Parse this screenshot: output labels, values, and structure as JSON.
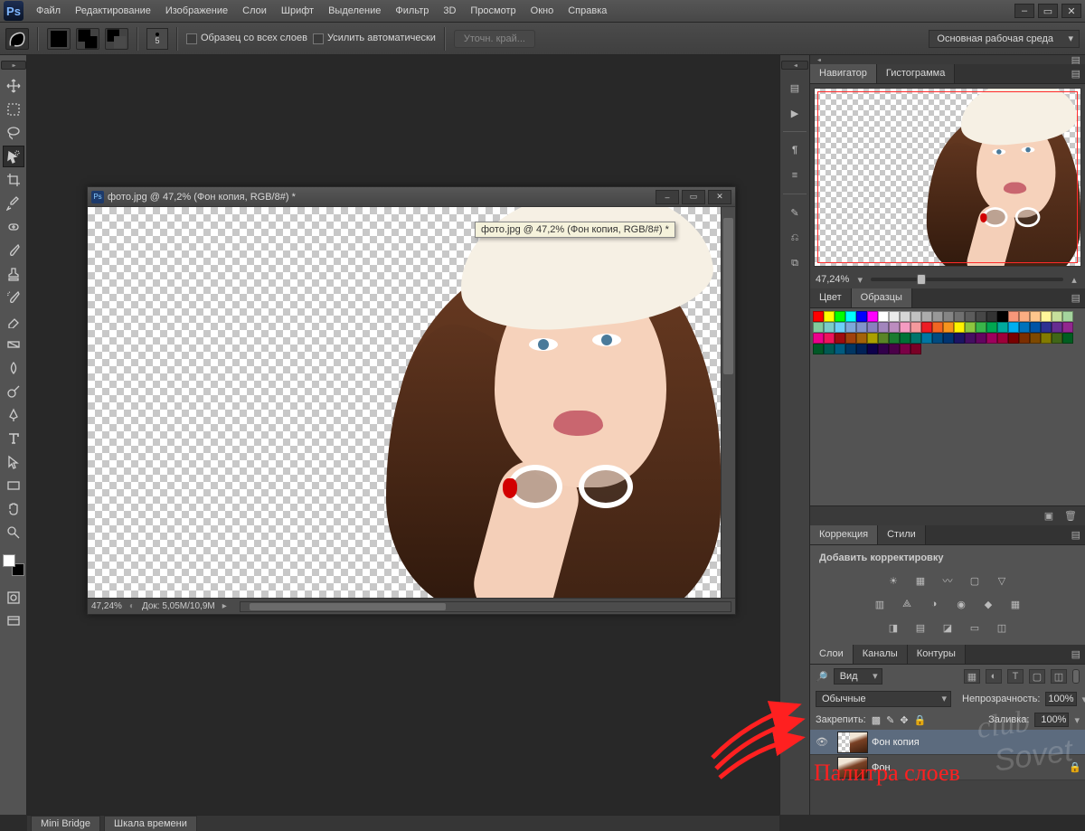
{
  "app": {
    "logo": "Ps"
  },
  "menu": {
    "items": [
      "Файл",
      "Редактирование",
      "Изображение",
      "Слои",
      "Шрифт",
      "Выделение",
      "Фильтр",
      "3D",
      "Просмотр",
      "Окно",
      "Справка"
    ]
  },
  "options_bar": {
    "brush_size_label": "5",
    "sample_all_label": "Образец со всех слоев",
    "auto_enhance_label": "Усилить автоматически",
    "refine_edge_label": "Уточн. край...",
    "workspace_label": "Основная рабочая среда"
  },
  "document": {
    "title": "фото.jpg @ 47,2% (Фон копия, RGB/8#) *",
    "tooltip": "фото.jpg @ 47,2% (Фон копия, RGB/8#) *",
    "status_zoom": "47,24%",
    "status_doc": "Док: 5,05M/10,9M"
  },
  "panels": {
    "navigator": {
      "tabs": [
        "Навигатор",
        "Гистограмма"
      ],
      "active": 0,
      "zoom_label": "47,24%"
    },
    "color": {
      "tabs": [
        "Цвет",
        "Образцы"
      ],
      "active": 1
    },
    "adjustments": {
      "tabs": [
        "Коррекция",
        "Стили"
      ],
      "active": 0,
      "add_label": "Добавить корректировку"
    },
    "layers": {
      "tabs": [
        "Слои",
        "Каналы",
        "Контуры"
      ],
      "active": 0,
      "filter_kind_label": "Вид",
      "blend_mode_label": "Обычные",
      "opacity_label": "Непрозрачность:",
      "opacity_value": "100%",
      "lock_label": "Закрепить:",
      "fill_label": "Заливка:",
      "fill_value": "100%",
      "items": [
        {
          "name": "Фон копия",
          "visible": true,
          "selected": true,
          "locked": false,
          "transparent_bg": true
        },
        {
          "name": "Фон",
          "visible": false,
          "selected": false,
          "locked": true,
          "transparent_bg": false
        }
      ]
    }
  },
  "bottom_tabs": [
    "Mini Bridge",
    "Шкала времени"
  ],
  "annotation": {
    "label": "Палитра слоев"
  },
  "swatch_colors": [
    "#ff0000",
    "#ffff00",
    "#00ff00",
    "#00ffff",
    "#0000ff",
    "#ff00ff",
    "#ffffff",
    "#ebebeb",
    "#d6d6d6",
    "#c2c2c2",
    "#adadad",
    "#999999",
    "#858585",
    "#707070",
    "#5c5c5c",
    "#474747",
    "#333333",
    "#000000",
    "#f7977a",
    "#fbad82",
    "#fdc68c",
    "#fff799",
    "#c6df9c",
    "#a4d49d",
    "#81ca9d",
    "#7accc8",
    "#6ccff7",
    "#7da7d9",
    "#8293ca",
    "#8881be",
    "#a286bd",
    "#bc8cbf",
    "#f49bc1",
    "#f5999d",
    "#ed1c24",
    "#f26522",
    "#f7941d",
    "#fff200",
    "#8dc63f",
    "#39b54a",
    "#00a651",
    "#00a99d",
    "#00aeef",
    "#0072bc",
    "#0054a6",
    "#2e3192",
    "#662d91",
    "#92278f",
    "#ec008c",
    "#ed145b",
    "#9e0b0f",
    "#a0410d",
    "#a36209",
    "#aba000",
    "#598527",
    "#1a7b30",
    "#007236",
    "#00746b",
    "#0076a3",
    "#004b80",
    "#003471",
    "#1b1464",
    "#440e62",
    "#630460",
    "#9e005d",
    "#9e0039",
    "#790000",
    "#7b2e00",
    "#7d4900",
    "#827b00",
    "#406618",
    "#005e20",
    "#005826",
    "#005952",
    "#005b7f",
    "#003663",
    "#002157",
    "#0d004c",
    "#32004b",
    "#4b0049",
    "#7b0046",
    "#7a0026"
  ]
}
